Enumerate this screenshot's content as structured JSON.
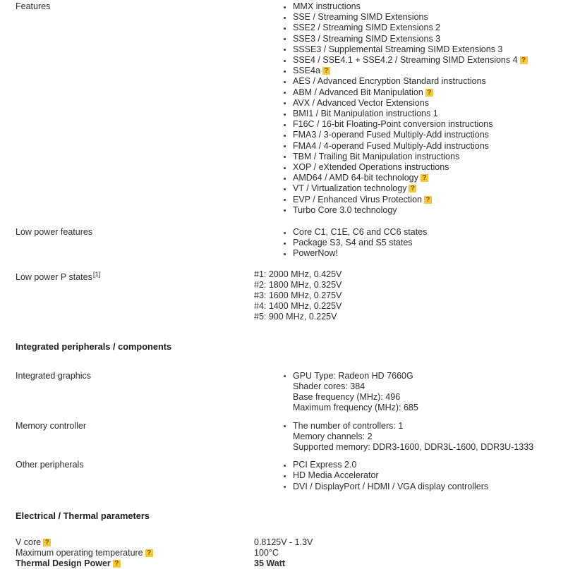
{
  "colors": {
    "help_badge_bg": "#f5c83c",
    "help_badge_text": "#7a5c00",
    "text": "#2b2b2b",
    "background": "#ffffff"
  },
  "help_glyph": "?",
  "footnote_marker": "[1]",
  "rows": [
    {
      "label": "Features",
      "items": [
        {
          "lines": [
            "MMX instructions"
          ],
          "help": false
        },
        {
          "lines": [
            "SSE / Streaming SIMD Extensions"
          ],
          "help": false
        },
        {
          "lines": [
            "SSE2 / Streaming SIMD Extensions 2"
          ],
          "help": false
        },
        {
          "lines": [
            "SSE3 / Streaming SIMD Extensions 3"
          ],
          "help": false
        },
        {
          "lines": [
            "SSSE3 / Supplemental Streaming SIMD Extensions 3"
          ],
          "help": false
        },
        {
          "lines": [
            "SSE4 / SSE4.1 + SSE4.2 / Streaming SIMD Extensions 4"
          ],
          "help": true
        },
        {
          "lines": [
            "SSE4a"
          ],
          "help": true
        },
        {
          "lines": [
            "AES / Advanced Encryption Standard instructions"
          ],
          "help": false
        },
        {
          "lines": [
            "ABM / Advanced Bit Manipulation"
          ],
          "help": true
        },
        {
          "lines": [
            "AVX / Advanced Vector Extensions"
          ],
          "help": false
        },
        {
          "lines": [
            "BMI1 / Bit Manipulation instructions 1"
          ],
          "help": false
        },
        {
          "lines": [
            "F16C / 16-bit Floating-Point conversion instructions"
          ],
          "help": false
        },
        {
          "lines": [
            "FMA3 / 3-operand Fused Multiply-Add instructions"
          ],
          "help": false
        },
        {
          "lines": [
            "FMA4 / 4-operand Fused Multiply-Add instructions"
          ],
          "help": false
        },
        {
          "lines": [
            "TBM / Trailing Bit Manipulation instructions"
          ],
          "help": false
        },
        {
          "lines": [
            "XOP / eXtended Operations instructions"
          ],
          "help": false
        },
        {
          "lines": [
            "AMD64 / AMD 64-bit technology"
          ],
          "help": true
        },
        {
          "lines": [
            "VT / Virtualization technology"
          ],
          "help": true
        },
        {
          "lines": [
            "EVP / Enhanced Virus Protection"
          ],
          "help": true
        },
        {
          "lines": [
            "Turbo Core 3.0 technology"
          ],
          "help": false
        }
      ]
    },
    {
      "label": "Low power features",
      "items": [
        {
          "lines": [
            "Core C1, C1E, C6 and CC6 states"
          ],
          "help": false
        },
        {
          "lines": [
            "Package S3, S4 and S5 states"
          ],
          "help": false
        },
        {
          "lines": [
            "PowerNow!"
          ],
          "help": false
        }
      ]
    }
  ],
  "low_power_p_states": {
    "label": "Low power P states",
    "has_footnote": true,
    "values": [
      "#1: 2000 MHz, 0.425V",
      "#2: 1800 MHz, 0.325V",
      "#3: 1600 MHz, 0.275V",
      "#4: 1400 MHz, 0.225V",
      "#5: 900 MHz, 0.225V"
    ]
  },
  "section_peripherals": {
    "heading": "Integrated peripherals / components",
    "rows": [
      {
        "label": "Integrated graphics",
        "items": [
          {
            "lines": [
              "GPU Type: Radeon HD 7660G",
              "Shader cores: 384",
              "Base frequency (MHz): 496",
              "Maximum frequency (MHz): 685"
            ],
            "help": false
          }
        ]
      },
      {
        "label": "Memory controller",
        "items": [
          {
            "lines": [
              "The number of controllers: 1",
              "Memory channels: 2",
              "Supported memory: DDR3-1600, DDR3L-1600, DDR3U-1333"
            ],
            "help": false
          }
        ]
      },
      {
        "label": "Other peripherals",
        "items": [
          {
            "lines": [
              "PCI Express 2.0"
            ],
            "help": false
          },
          {
            "lines": [
              "HD Media Accelerator"
            ],
            "help": false
          },
          {
            "lines": [
              "DVI / DisplayPort / HDMI / VGA display controllers"
            ],
            "help": false
          }
        ]
      }
    ]
  },
  "section_electrical": {
    "heading": "Electrical / Thermal parameters",
    "rows": [
      {
        "label": "V core",
        "help": true,
        "value": "0.8125V - 1.3V",
        "bold": false
      },
      {
        "label": "Maximum operating temperature",
        "help": true,
        "value": "100°C",
        "bold": false
      },
      {
        "label": "Thermal Design Power",
        "help": true,
        "value": "35 Watt",
        "bold": true
      }
    ]
  }
}
